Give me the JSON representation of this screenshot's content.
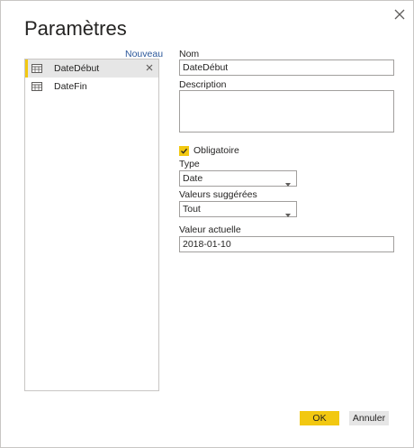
{
  "dialog": {
    "title": "Paramètres",
    "close_icon": "close-icon"
  },
  "sidebar": {
    "new_label": "Nouveau",
    "items": [
      {
        "label": "DateDébut",
        "selected": true,
        "icon": "table-icon"
      },
      {
        "label": "DateFin",
        "selected": false,
        "icon": "table-icon"
      }
    ]
  },
  "form": {
    "name_label": "Nom",
    "name_value": "DateDébut",
    "description_label": "Description",
    "description_value": "",
    "required_label": "Obligatoire",
    "required_checked": true,
    "type_label": "Type",
    "type_value": "Date",
    "suggested_label": "Valeurs suggérées",
    "suggested_value": "Tout",
    "current_label": "Valeur actuelle",
    "current_value": "2018-01-10"
  },
  "footer": {
    "ok_label": "OK",
    "cancel_label": "Annuler"
  },
  "colors": {
    "accent": "#f2c811",
    "link": "#2b579a",
    "border": "#a19f9d",
    "selected_bg": "#e6e6e6"
  }
}
